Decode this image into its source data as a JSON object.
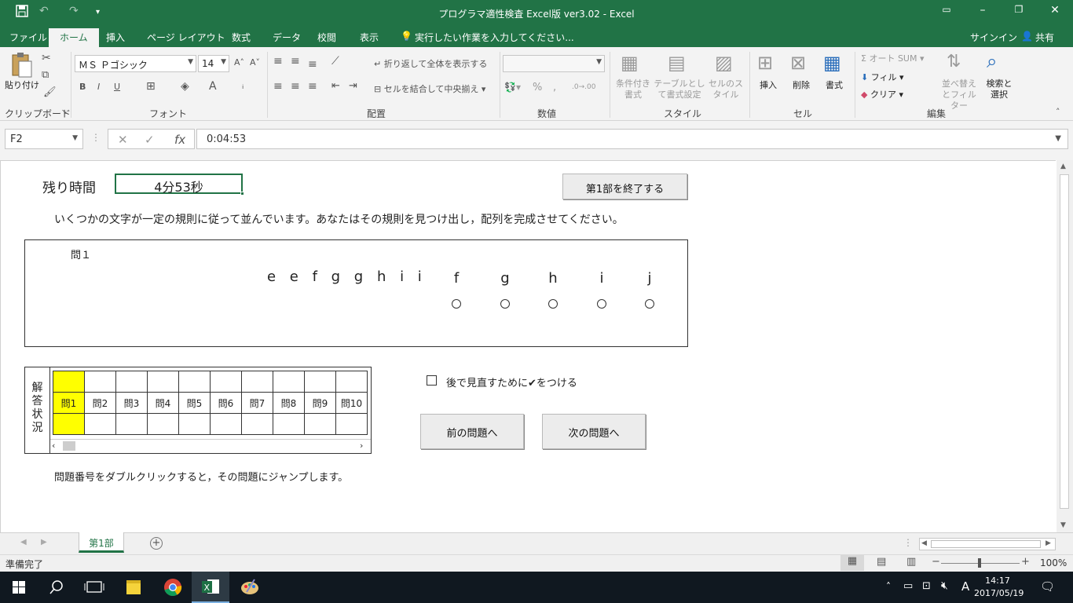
{
  "window": {
    "title": "プログラマ適性検査 Excel版 ver3.02 - Excel"
  },
  "menu": {
    "tabs": [
      "ファイル",
      "ホーム",
      "挿入",
      "ページ レイアウト",
      "数式",
      "データ",
      "校閲",
      "表示"
    ],
    "active_tab": "ホーム",
    "tell_me": "実行したい作業を入力してください...",
    "signin": "サインイン",
    "share": "共有"
  },
  "ribbon": {
    "clipboard": {
      "paste": "貼り付け",
      "label": "クリップボード"
    },
    "font": {
      "name": "ＭＳ Ｐゴシック",
      "size": "14",
      "label": "フォント",
      "bold": "B",
      "italic": "I",
      "underline": "U"
    },
    "alignment": {
      "wrap": "折り返して全体を表示する",
      "merge": "セルを結合して中央揃え",
      "label": "配置"
    },
    "number": {
      "label": "数値",
      "percent": "%"
    },
    "styles": {
      "conditional": "条件付き書式",
      "table": "テーブルとして書式設定",
      "cell": "セルのスタイル",
      "label": "スタイル"
    },
    "cells": {
      "insert": "挿入",
      "delete": "削除",
      "format": "書式",
      "label": "セル"
    },
    "editing": {
      "autosum": "オート SUM",
      "fill": "フィル",
      "clear": "クリア",
      "sort": "並べ替えとフィルター",
      "find": "検索と選択",
      "label": "編集"
    }
  },
  "formula_bar": {
    "name_box": "F2",
    "value": "0:04:53"
  },
  "sheet": {
    "timer_label": "残り時間",
    "timer_value": "4分53秒",
    "end_button": "第1部を終了する",
    "instructions": "いくつかの文字が一定の規則に従って並んでいます。あなたはその規則を見つけ出し，配列を完成させてください。",
    "question": {
      "label": "問１",
      "sequence": "e e f g g h i i",
      "choices": [
        "f",
        "g",
        "h",
        "i",
        "j"
      ]
    },
    "status_title": [
      "解",
      "答",
      "状",
      "況"
    ],
    "question_numbers": [
      "問1",
      "問2",
      "問3",
      "問4",
      "問5",
      "問6",
      "問7",
      "問8",
      "問9",
      "問10"
    ],
    "current_question": 1,
    "review_checkbox": "後で見直すために✔をつける",
    "prev_button": "前の問題へ",
    "next_button": "次の問題へ",
    "hint": "問題番号をダブルクリックすると，その問題にジャンプします。"
  },
  "sheet_tabs": {
    "tab": "第1部"
  },
  "status": {
    "text": "準備完了",
    "zoom": "100%"
  },
  "taskbar": {
    "time": "14:17",
    "date": "2017/05/19",
    "ime": "A"
  },
  "colors": {
    "excel_green": "#217346",
    "highlight_yellow": "#ffff00"
  }
}
